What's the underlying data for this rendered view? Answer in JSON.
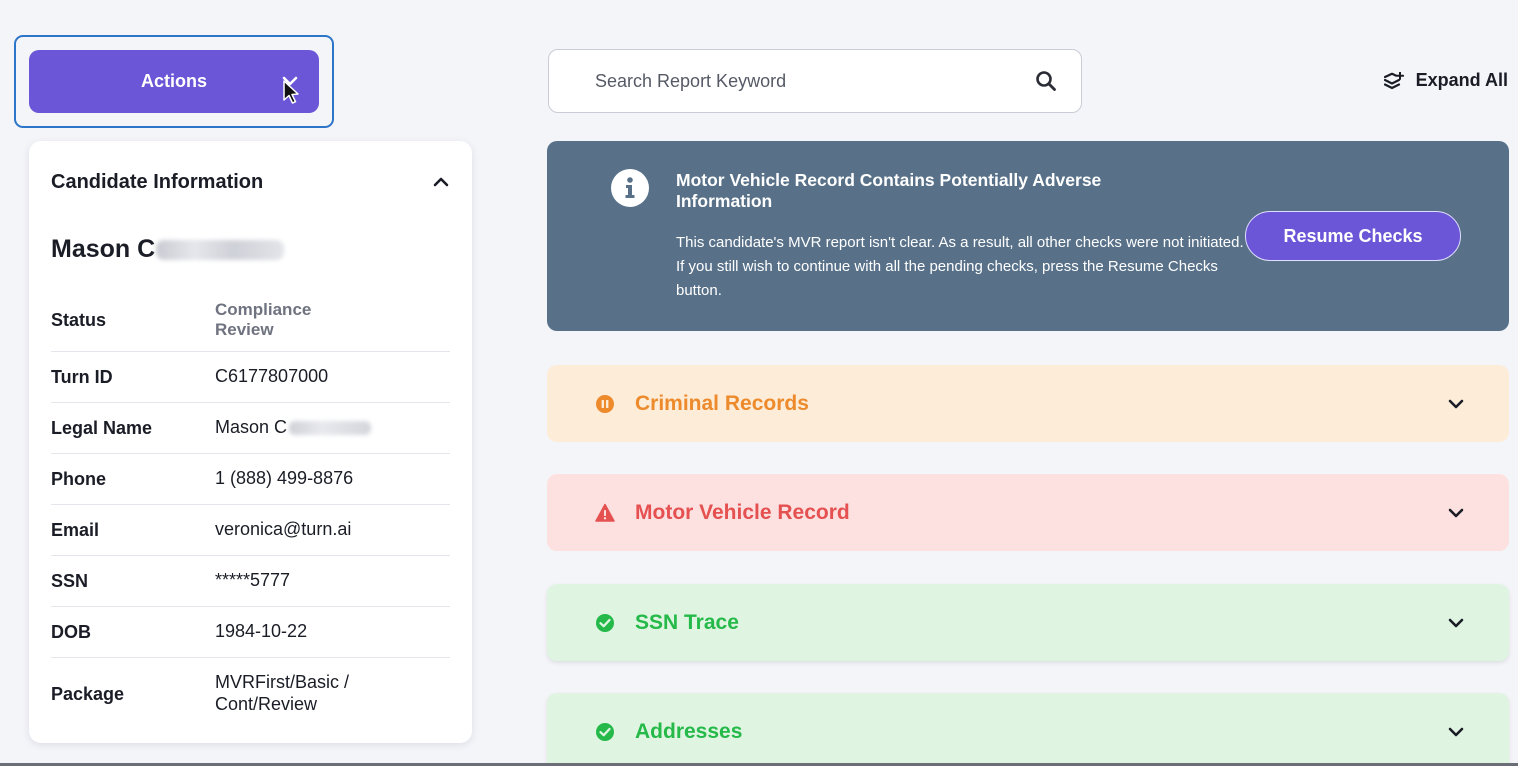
{
  "actions": {
    "label": "Actions"
  },
  "candidate": {
    "header": "Candidate Information",
    "name_visible": "Mason C",
    "rows": [
      {
        "label": "Status",
        "value": "Compliance\nReview"
      },
      {
        "label": "Turn ID",
        "value": "C6177807000"
      },
      {
        "label": "Legal Name",
        "value": "Mason C"
      },
      {
        "label": "Phone",
        "value": "1 (888) 499-8876"
      },
      {
        "label": "Email",
        "value": "veronica@turn.ai"
      },
      {
        "label": "SSN",
        "value": "*****5777"
      },
      {
        "label": "DOB",
        "value": "1984-10-22"
      },
      {
        "label": "Package",
        "value": "MVRFirst/Basic /\nCont/Review"
      }
    ]
  },
  "search": {
    "placeholder": "Search Report Keyword",
    "value": ""
  },
  "expand_all": {
    "label": "Expand All"
  },
  "alert": {
    "title": "Motor Vehicle Record Contains Potentially Adverse Information",
    "body": "This candidate's MVR report isn't clear. As a result, all other checks were not initiated. If you still wish to continue with all the pending checks, press the Resume Checks button.",
    "button": "Resume Checks"
  },
  "sections": [
    {
      "title": "Criminal Records",
      "status": "paused",
      "icon": "pause-circle-icon",
      "color": "#ec8a2c"
    },
    {
      "title": "Motor Vehicle Record",
      "status": "alert",
      "icon": "warning-triangle-icon",
      "color": "#e55050"
    },
    {
      "title": "SSN Trace",
      "status": "clear",
      "icon": "check-circle-icon",
      "color": "#25b94a"
    },
    {
      "title": "Addresses",
      "status": "clear",
      "icon": "check-circle-icon",
      "color": "#25b94a"
    }
  ],
  "colors": {
    "accent": "#6a56d6",
    "banner": "#587189",
    "focus_outline": "#2c75c9"
  }
}
